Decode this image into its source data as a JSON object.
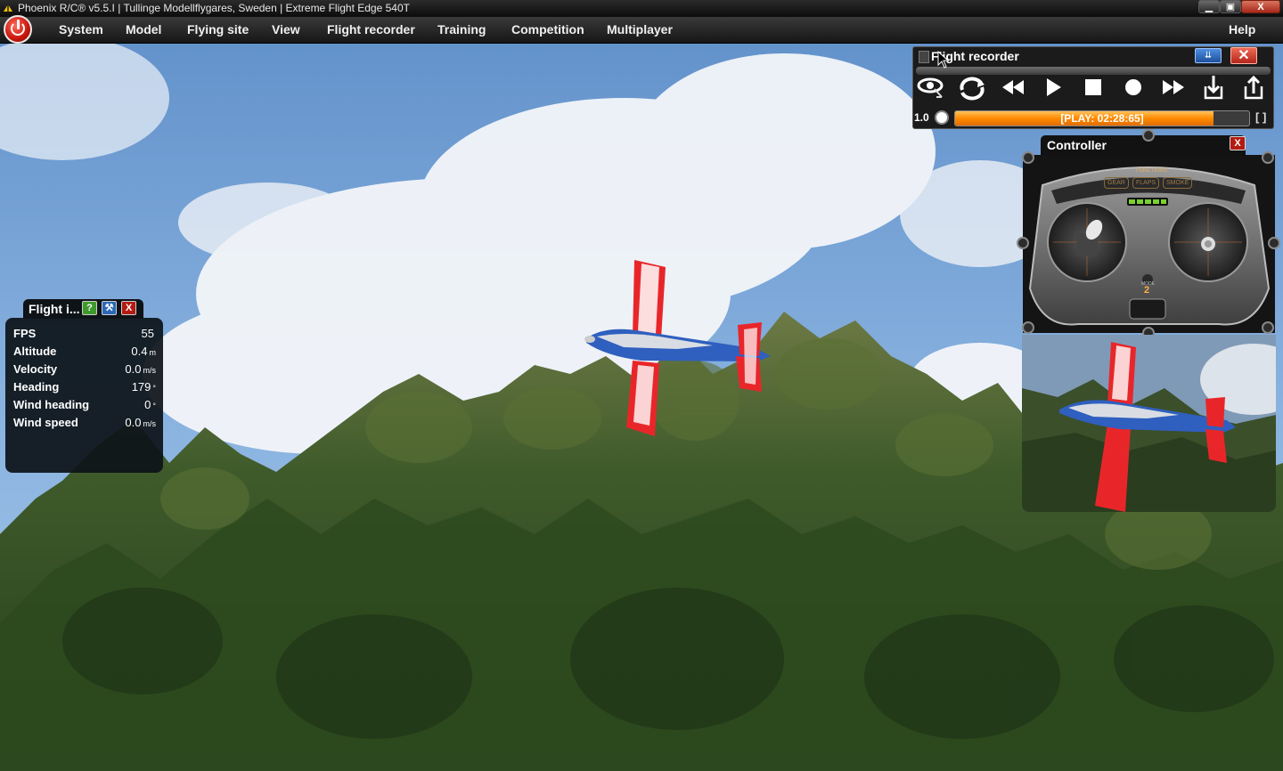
{
  "window": {
    "title": "Phoenix R/C® v5.5.I  |  Tullinge Modellflygares, Sweden  |  Extreme Flight Edge 540T",
    "min_glyph": "▁",
    "max_glyph": "▣",
    "close_glyph": "X"
  },
  "menu": {
    "items": [
      "System",
      "Model",
      "Flying site",
      "View",
      "Flight recorder",
      "Training",
      "Competition",
      "Multiplayer"
    ],
    "help": "Help"
  },
  "flight_info": {
    "title": "Flight i...",
    "help_glyph": "?",
    "settings_glyph": "⚒",
    "close_glyph": "X",
    "rows": [
      {
        "label": "FPS",
        "value": "55",
        "unit": ""
      },
      {
        "label": "Altitude",
        "value": "0.4",
        "unit": "m"
      },
      {
        "label": "Velocity",
        "value": "0.0",
        "unit": "m/s"
      },
      {
        "label": "Heading",
        "value": "179",
        "unit": "°"
      },
      {
        "label": "Wind heading",
        "value": "0",
        "unit": "°"
      },
      {
        "label": "Wind speed",
        "value": "0.0",
        "unit": "m/s"
      }
    ]
  },
  "recorder": {
    "title": "Flight recorder",
    "collapse_glyph": "⇊",
    "close_glyph": "✕",
    "zoom": "1.0",
    "status": "[PLAY: 02:28:65]",
    "progress": 0.88,
    "bracket": "[ ]",
    "tools": [
      "view-eye-icon",
      "loop-icon",
      "rewind-icon",
      "play-icon",
      "stop-icon",
      "record-icon",
      "fast-forward-icon",
      "import-icon",
      "export-icon"
    ]
  },
  "controller": {
    "title": "Controller",
    "close_glyph": "X",
    "functions_label": "FUNCTIONS",
    "functions": [
      "GEAR",
      "FLAPS",
      "SMOKE"
    ],
    "mode_label": "MODE",
    "mode_value": "2"
  },
  "colors": {
    "accent_orange": "#ff8a00",
    "close_red": "#b31b12",
    "help_green": "#3f9a2d",
    "settings_blue": "#2b68b7"
  }
}
